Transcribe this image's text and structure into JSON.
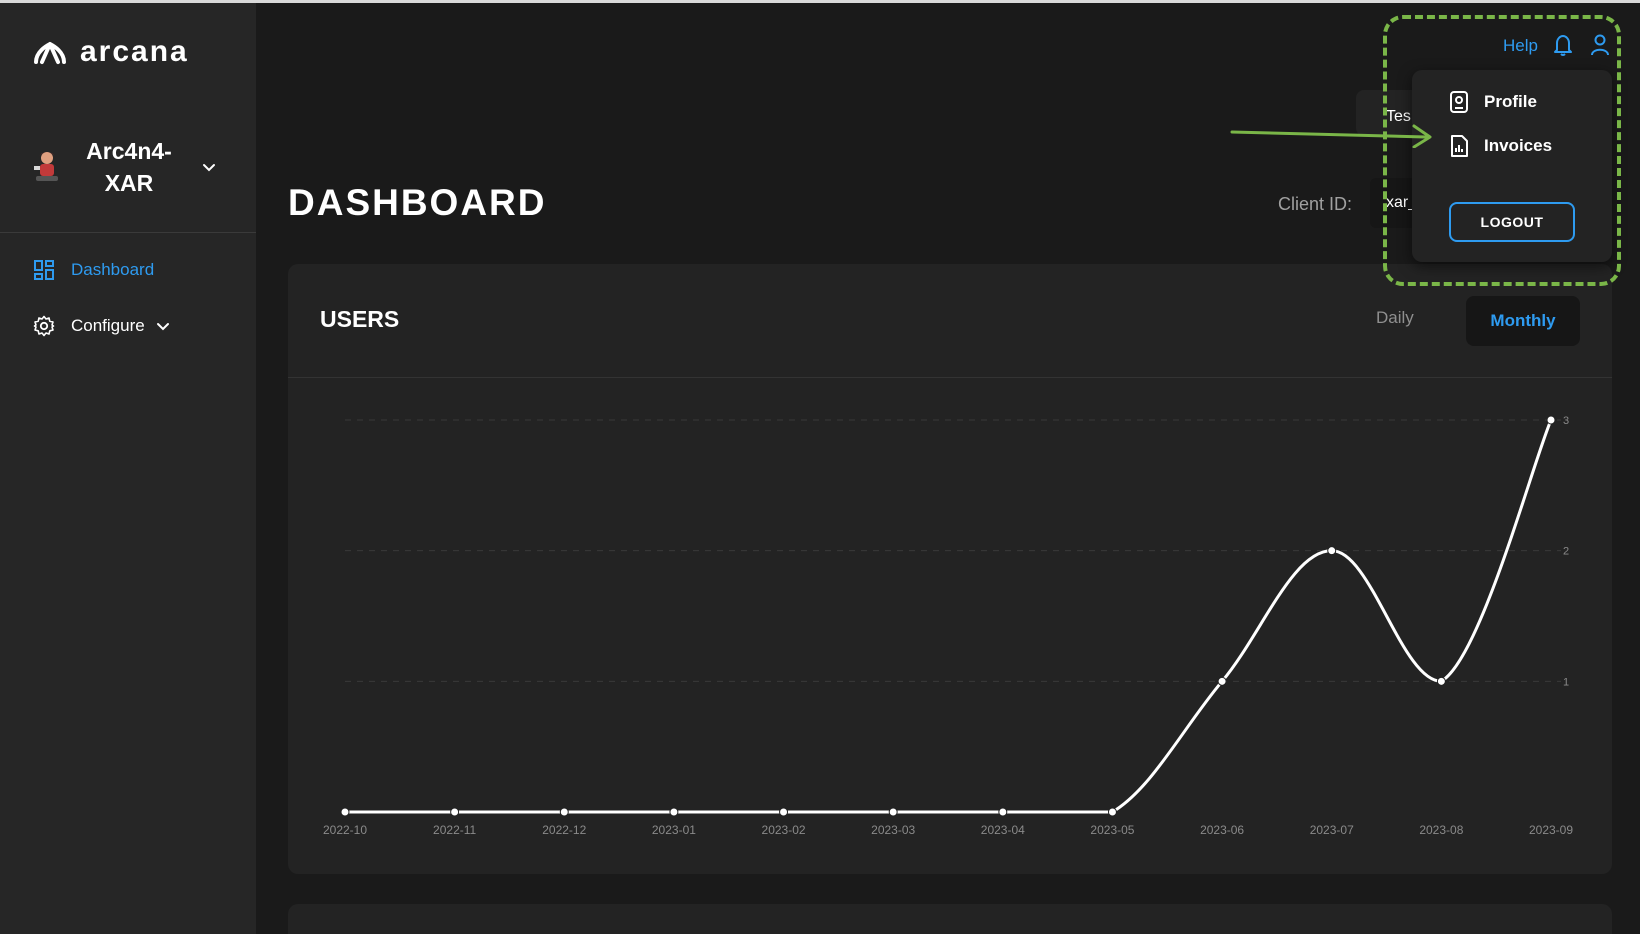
{
  "brand": {
    "name": "arcana"
  },
  "app_switcher": {
    "name": "Arc4n4-XAR"
  },
  "sidebar": {
    "items": [
      {
        "label": "Dashboard",
        "icon": "dashboard-icon",
        "active": true
      },
      {
        "label": "Configure",
        "icon": "gear-icon",
        "active": false
      }
    ]
  },
  "header": {
    "help": "Help",
    "network_chip": "Tes",
    "client_id_label": "Client ID:",
    "client_id_value": "xar_"
  },
  "user_menu": {
    "profile": "Profile",
    "invoices": "Invoices",
    "logout": "LOGOUT"
  },
  "page": {
    "title": "DASHBOARD"
  },
  "users_card": {
    "title": "USERS",
    "toggle_daily": "Daily",
    "toggle_monthly": "Monthly",
    "selected": "Monthly"
  },
  "colors": {
    "accent": "#2e9bf0",
    "background": "#1a1a1a",
    "sidebar": "#262626",
    "card": "#232323",
    "annotation": "#7ab648"
  },
  "chart_data": {
    "type": "line",
    "categories": [
      "2022-10",
      "2022-11",
      "2022-12",
      "2023-01",
      "2023-02",
      "2023-03",
      "2023-04",
      "2023-05",
      "2023-06",
      "2023-07",
      "2023-08",
      "2023-09"
    ],
    "values": [
      0,
      0,
      0,
      0,
      0,
      0,
      0,
      0,
      1,
      2,
      1,
      3
    ],
    "ylim": [
      0,
      3
    ],
    "yticks": [
      "1",
      "2",
      "3"
    ],
    "grid": true,
    "title": "",
    "xlabel": "",
    "ylabel": ""
  }
}
